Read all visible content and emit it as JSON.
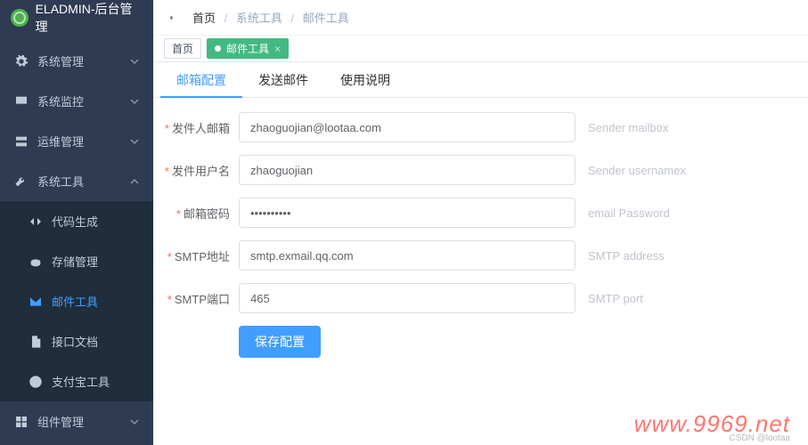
{
  "app": {
    "title": "ELADMIN-后台管理"
  },
  "sidebar": {
    "items": [
      {
        "label": "系统管理"
      },
      {
        "label": "系统监控"
      },
      {
        "label": "运维管理"
      },
      {
        "label": "系统工具"
      },
      {
        "label": "组件管理"
      }
    ],
    "submenu": [
      {
        "label": "代码生成"
      },
      {
        "label": "存储管理"
      },
      {
        "label": "邮件工具"
      },
      {
        "label": "接口文档"
      },
      {
        "label": "支付宝工具"
      }
    ]
  },
  "breadcrumb": {
    "home": "首页",
    "mid": "系统工具",
    "last": "邮件工具"
  },
  "tags": {
    "home": "首页",
    "active": "邮件工具"
  },
  "tabs": {
    "a": "邮箱配置",
    "b": "发送邮件",
    "c": "使用说明"
  },
  "form": {
    "f1": {
      "label": "发件人邮箱",
      "value": "zhaoguojian@lootaa.com",
      "hint": "Sender mailbox"
    },
    "f2": {
      "label": "发件用户名",
      "value": "zhaoguojian",
      "hint": "Sender usernamex"
    },
    "f3": {
      "label": "邮箱密码",
      "value": "••••••••••",
      "hint": "email Password"
    },
    "f4": {
      "label": "SMTP地址",
      "value": "smtp.exmail.qq.com",
      "hint": "SMTP address"
    },
    "f5": {
      "label": "SMTP端口",
      "value": "465",
      "hint": "SMTP port"
    },
    "submit": "保存配置"
  },
  "watermark": {
    "main": "www.9969.net",
    "sub": "CSDN @lootaa"
  }
}
